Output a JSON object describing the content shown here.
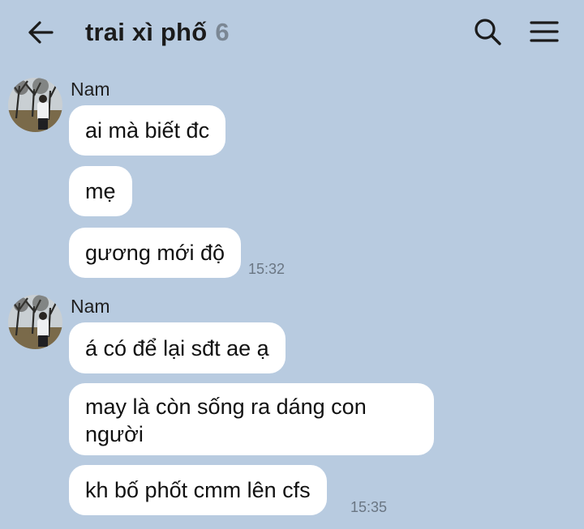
{
  "header": {
    "title": "trai xì phố",
    "member_count": "6",
    "back_icon": "arrow-left-icon",
    "search_icon": "search-icon",
    "menu_icon": "hamburger-menu-icon"
  },
  "groups": [
    {
      "sender": "Nam",
      "messages": [
        "ai mà biết đc",
        "mẹ",
        "gương mới độ"
      ],
      "time": "15:32"
    },
    {
      "sender": "Nam",
      "messages": [
        "á có để lại sđt ae ạ",
        "may là còn sống ra dáng con người",
        "kh bố phốt cmm lên cfs"
      ],
      "time": "15:35"
    }
  ],
  "colors": {
    "background": "#b8cbe0",
    "bubble": "#ffffff",
    "title_count": "#7b8794",
    "timestamp": "#6a7683"
  }
}
